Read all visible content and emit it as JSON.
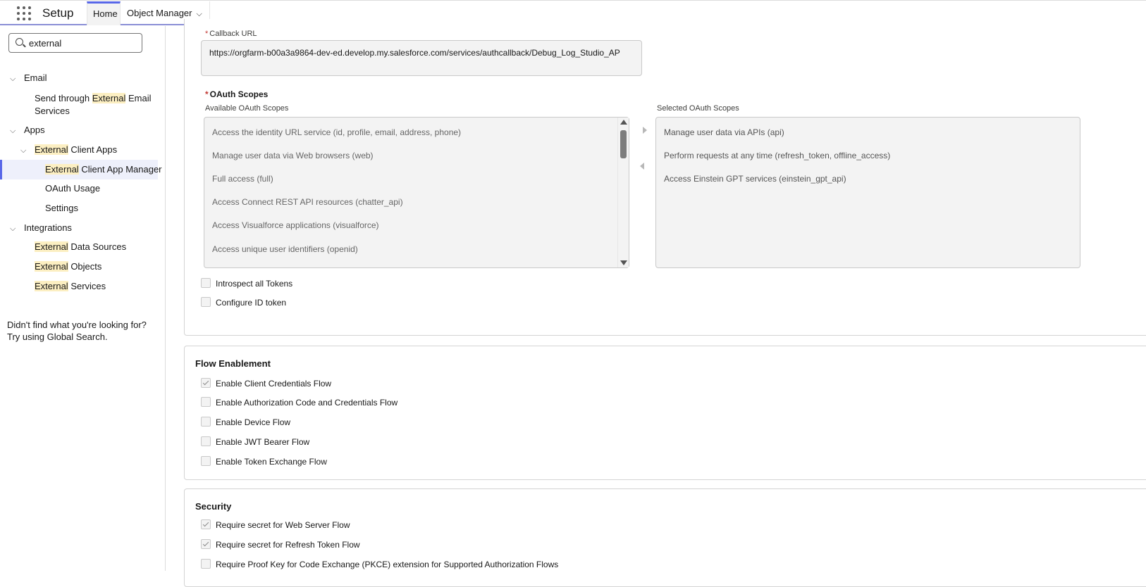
{
  "header": {
    "app_name": "Setup",
    "tabs": [
      {
        "label": "Home"
      },
      {
        "label": "Object Manager"
      }
    ]
  },
  "sidebar": {
    "search": {
      "value": "external"
    },
    "tree": {
      "email": {
        "label": "Email"
      },
      "send_external_pre": "Send through ",
      "send_external_hl": "External",
      "send_external_post": " Email",
      "send_external_line2": "Services",
      "apps": {
        "label": "Apps"
      },
      "ext_client_apps_hl": "External",
      "ext_client_apps_post": " Client Apps",
      "ext_client_mgr_hl": "External",
      "ext_client_mgr_post": " Client App Manager",
      "oauth_usage": "OAuth Usage",
      "settings": "Settings",
      "integrations": {
        "label": "Integrations"
      },
      "ext_data_hl": "External",
      "ext_data_post": " Data Sources",
      "ext_objects_hl": "External",
      "ext_objects_post": " Objects",
      "ext_services_hl": "External",
      "ext_services_post": " Services"
    },
    "help_text": "Didn't find what you're looking for? Try using Global Search."
  },
  "oauth_settings": {
    "callback_label": "Callback URL",
    "required_mark": "*",
    "callback_value": "https://orgfarm-b00a3a9864-dev-ed.develop.my.salesforce.com/services/authcallback/Debug_Log_Studio_AP",
    "scopes_title": "OAuth Scopes",
    "available_label": "Available OAuth Scopes",
    "selected_label": "Selected OAuth Scopes",
    "available_scopes": [
      "Access the identity URL service (id, profile, email, address, phone)",
      "Manage user data via Web browsers (web)",
      "Full access (full)",
      "Access Connect REST API resources (chatter_api)",
      "Access Visualforce applications (visualforce)",
      "Access unique user identifiers (openid)"
    ],
    "selected_scopes": [
      "Manage user data via APIs (api)",
      "Perform requests at any time (refresh_token, offline_access)",
      "Access Einstein GPT services (einstein_gpt_api)"
    ],
    "introspect_label": "Introspect all Tokens",
    "config_id_label": "Configure ID token"
  },
  "flow_enablement": {
    "title": "Flow Enablement",
    "items": [
      {
        "label": "Enable Client Credentials Flow",
        "checked": true
      },
      {
        "label": "Enable Authorization Code and Credentials Flow",
        "checked": false
      },
      {
        "label": "Enable Device Flow",
        "checked": false
      },
      {
        "label": "Enable JWT Bearer Flow",
        "checked": false
      },
      {
        "label": "Enable Token Exchange Flow",
        "checked": false
      }
    ]
  },
  "security": {
    "title": "Security",
    "items": [
      {
        "label": "Require secret for Web Server Flow",
        "checked": true
      },
      {
        "label": "Require secret for Refresh Token Flow",
        "checked": true
      },
      {
        "label": "Require Proof Key for Code Exchange (PKCE) extension for Supported Authorization Flows",
        "checked": false
      }
    ]
  }
}
